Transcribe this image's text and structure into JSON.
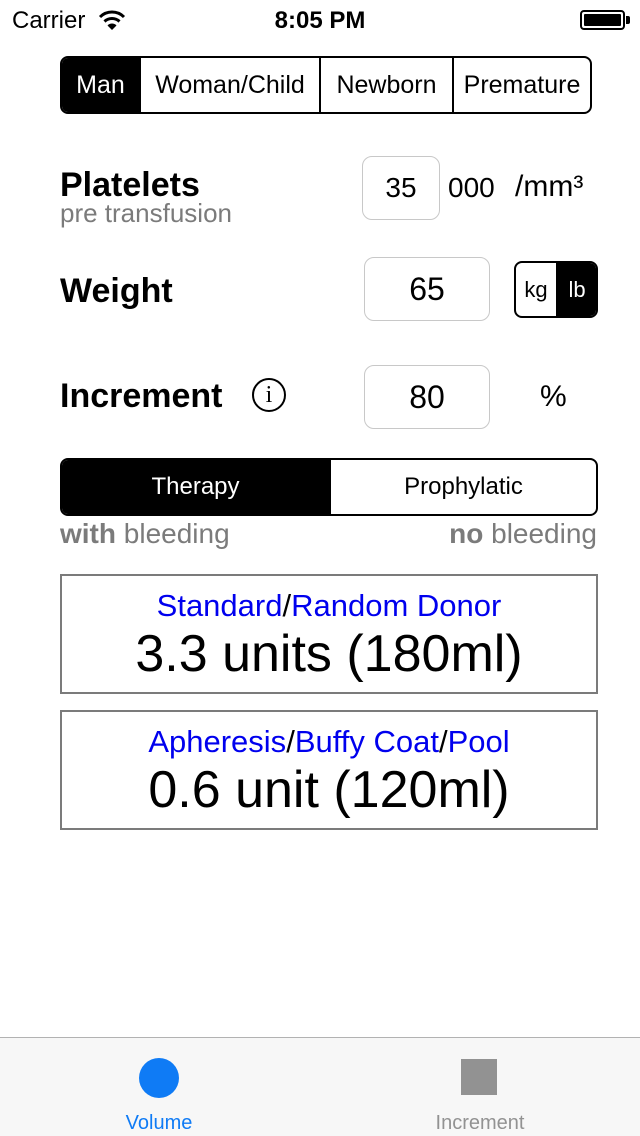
{
  "status_bar": {
    "carrier": "Carrier",
    "time": "8:05 PM"
  },
  "population": {
    "options": [
      "Man",
      "Woman/Child",
      "Newborn",
      "Premature"
    ],
    "selected": "Man"
  },
  "platelets": {
    "label": "Platelets",
    "sublabel": "pre transfusion",
    "value": "35",
    "suffix": "000",
    "unit": "/mm³"
  },
  "weight": {
    "label": "Weight",
    "value": "65",
    "units": [
      "kg",
      "lb"
    ],
    "selected_unit": "lb"
  },
  "increment": {
    "label": "Increment",
    "info_icon": "i",
    "value": "80",
    "unit": "%"
  },
  "mode": {
    "options": [
      "Therapy",
      "Prophylatic"
    ],
    "selected": "Therapy",
    "hint_left_bold": "with",
    "hint_left_rest": " bleeding",
    "hint_right_bold": "no",
    "hint_right_rest": " bleeding"
  },
  "results": [
    {
      "types": [
        "Standard",
        "Random Donor"
      ],
      "value": "3.3 units (180ml)"
    },
    {
      "types": [
        "Apheresis",
        "Buffy Coat",
        "Pool"
      ],
      "value": "0.6 unit (120ml)"
    }
  ],
  "tabbar": {
    "tabs": [
      {
        "label": "Volume",
        "icon": "circle-icon",
        "active": true
      },
      {
        "label": "Increment",
        "icon": "square-icon",
        "active": false
      }
    ]
  },
  "colors": {
    "accent": "#0f7bf5",
    "link": "#0000ee",
    "muted": "#7b7b7b"
  }
}
